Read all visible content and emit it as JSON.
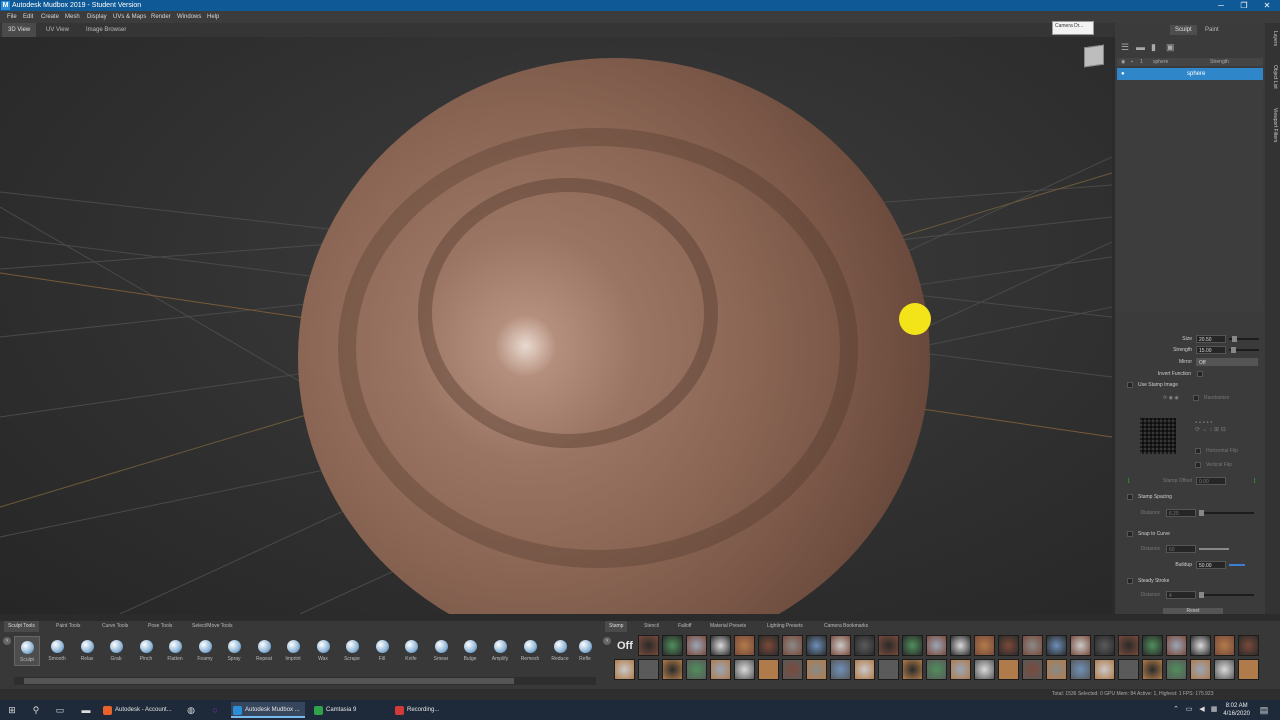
{
  "window": {
    "title": "Autodesk Mudbox 2019 - Student Version",
    "app_icon": "M",
    "controls": [
      "─",
      "❐",
      "✕"
    ]
  },
  "menu": [
    "File",
    "Edit",
    "Create",
    "Mesh",
    "Display",
    "UVs & Maps",
    "Render",
    "Windows",
    "Help"
  ],
  "view_tabs": [
    "3D View",
    "UV View",
    "Image Browser"
  ],
  "camera_dropdown": "Camera Dr...",
  "right_panel": {
    "tabs": [
      "Sculpt",
      "Paint"
    ],
    "layers_header": {
      "col1": "1",
      "name": "sphere",
      "col2": "Strength"
    },
    "selected_layer": "sphere",
    "side_tabs": [
      "Layers",
      "Object List",
      "Viewport Filters"
    ]
  },
  "properties": {
    "size_label": "Size",
    "size_value": "20.50",
    "strength_label": "Strength",
    "strength_value": "15.00",
    "mirror_label": "Mirror",
    "mirror_value": "Off",
    "invert_function": "Invert Function",
    "use_stamp_image": "Use Stamp Image",
    "randomize": "Randomize",
    "horizontal_flip": "Horizontal Flip",
    "vertical_flip": "Vertical Flip",
    "stamp_offset_label": "Stamp Offset",
    "stamp_offset_value": "0.00",
    "stamp_spacing": "Stamp Spacing",
    "distance_label": "Distance",
    "distance_value": "6.25",
    "snap_to_curve": "Snap to Curve",
    "distance2_value": "60",
    "falloff_label": "Buildup",
    "falloff_value": "50.00",
    "steady_stroke": "Steady Stroke",
    "distance3_value": "4",
    "reset": "Reset"
  },
  "tool_tabs": [
    "Sculpt Tools",
    "Paint Tools",
    "Curve Tools",
    "Pose Tools",
    "Select/Move Tools"
  ],
  "tools": [
    "Sculpt",
    "Smooth",
    "Relax",
    "Grab",
    "Pinch",
    "Flatten",
    "Foamy",
    "Spray",
    "Repeat",
    "Imprint",
    "Wax",
    "Scrape",
    "Fill",
    "Knife",
    "Smear",
    "Bulge",
    "Amplify",
    "Remesh",
    "Reduce",
    "Refle"
  ],
  "stamp_tabs": [
    "Stamp",
    "Stencil",
    "Falloff",
    "Material Presets",
    "Lighting Presets",
    "Camera Bookmarks"
  ],
  "stamp_off": "Off",
  "status": "Total: 1536  Selected: 0  GPU Mem: 84  Active: 1, Highest: 1  FPS: 175.923",
  "taskbar": {
    "items": [
      "Autodesk - Account...",
      "Autodesk Mudbox ...",
      "Camtasia 9",
      "Recording..."
    ],
    "time": "8:02 AM",
    "date": "4/16/2020"
  }
}
